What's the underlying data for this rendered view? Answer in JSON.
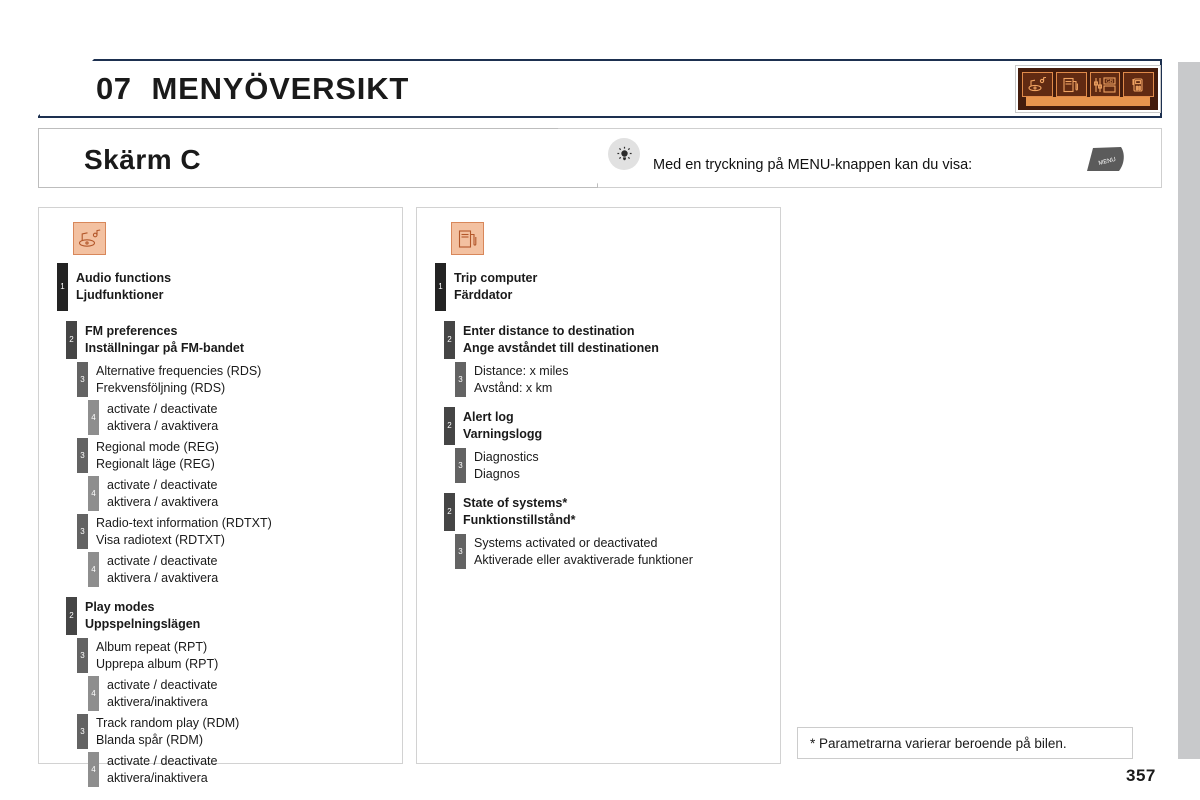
{
  "header": {
    "chapter_number": "07",
    "chapter_title": "MENYÖVERSIKT",
    "icon_strip": [
      {
        "name": "audio-icon"
      },
      {
        "name": "trip-computer-icon"
      },
      {
        "name": "settings-icon"
      },
      {
        "name": "telephone-icon"
      }
    ]
  },
  "subtitle": {
    "screen_label": "Skärm C",
    "bulb_icon": "lightbulb-icon",
    "text": "Med en tryckning på MENU-knappen kan du visa:",
    "menu_key_label": "MENU"
  },
  "panels": [
    {
      "id": "audio-panel",
      "icon": "audio-functions-icon",
      "rows": [
        {
          "level": 1,
          "en": "Audio functions",
          "sv": "Ljudfunktioner"
        },
        {
          "level": 2,
          "en": "FM preferences",
          "sv": "Inställningar på FM-bandet"
        },
        {
          "level": 3,
          "en": "Alternative frequencies (RDS)",
          "sv": "Frekvensföljning (RDS)"
        },
        {
          "level": 4,
          "en": "activate / deactivate",
          "sv": "aktivera / avaktivera"
        },
        {
          "level": 3,
          "en": "Regional mode (REG)",
          "sv": "Regionalt läge (REG)"
        },
        {
          "level": 4,
          "en": "activate / deactivate",
          "sv": "aktivera / avaktivera"
        },
        {
          "level": 3,
          "en": "Radio-text information (RDTXT)",
          "sv": "Visa radiotext (RDTXT)"
        },
        {
          "level": 4,
          "en": "activate / deactivate",
          "sv": "aktivera / avaktivera"
        },
        {
          "level": 2,
          "en": "Play modes",
          "sv": "Uppspelningslägen"
        },
        {
          "level": 3,
          "en": "Album repeat (RPT)",
          "sv": "Upprepa album (RPT)"
        },
        {
          "level": 4,
          "en": "activate / deactivate",
          "sv": "aktivera/inaktivera"
        },
        {
          "level": 3,
          "en": "Track random play (RDM)",
          "sv": "Blanda spår (RDM)"
        },
        {
          "level": 4,
          "en": "activate / deactivate",
          "sv": "aktivera/inaktivera"
        }
      ]
    },
    {
      "id": "trip-computer-panel",
      "icon": "fuel-pump-icon",
      "rows": [
        {
          "level": 1,
          "en": "Trip computer",
          "sv": "Färddator"
        },
        {
          "level": 2,
          "en": "Enter distance to destination",
          "sv": "Ange avståndet till destinationen"
        },
        {
          "level": 3,
          "en": "Distance: x miles",
          "sv": "Avstånd: x km"
        },
        {
          "level": 2,
          "en": "Alert log",
          "sv": "Varningslogg"
        },
        {
          "level": 3,
          "en": "Diagnostics",
          "sv": "Diagnos"
        },
        {
          "level": 2,
          "en": "State of systems*",
          "sv": "Funktionstillstånd*"
        },
        {
          "level": 3,
          "en": "Systems activated or deactivated",
          "sv": "Aktiverade eller avaktiverade funktioner"
        }
      ]
    }
  ],
  "footnote": "* Parametrarna varierar beroende på bilen.",
  "page_number": "357",
  "colors": {
    "header_border": "#1d3050",
    "icon_strip_bg": "#441c0c",
    "icon_accent": "#e8954e",
    "panel_icon_bg": "#f3c1a1",
    "level1": "#232323",
    "level2": "#454545",
    "level3": "#636363",
    "level4": "#8e8e8e"
  }
}
